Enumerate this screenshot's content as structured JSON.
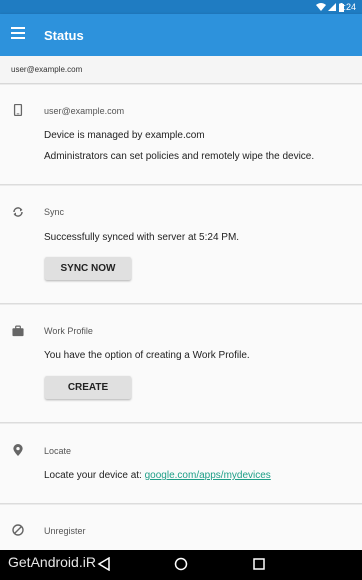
{
  "status_bar": {
    "time": "5:24"
  },
  "appbar": {
    "title": "Status"
  },
  "account": {
    "email": "user@example.com"
  },
  "device_card": {
    "heading": "user@example.com",
    "line1": "Device is managed by example.com",
    "line2": "Administrators can set policies and remotely wipe the device."
  },
  "sync_card": {
    "heading": "Sync",
    "message": "Successfully synced with server at 5:24 PM.",
    "button": "SYNC NOW"
  },
  "work_card": {
    "heading": "Work Profile",
    "message": "You have the option of creating a Work Profile.",
    "button": "CREATE"
  },
  "locate_card": {
    "heading": "Locate",
    "message_prefix": "Locate your device at: ",
    "link": "google.com/apps/mydevices"
  },
  "unregister_card": {
    "heading": "Unregister"
  },
  "watermark": "GetAndroid.iR",
  "colors": {
    "statusbar": "#1f7cc2",
    "appbar": "#2d92dc",
    "link": "#1e9e87"
  }
}
